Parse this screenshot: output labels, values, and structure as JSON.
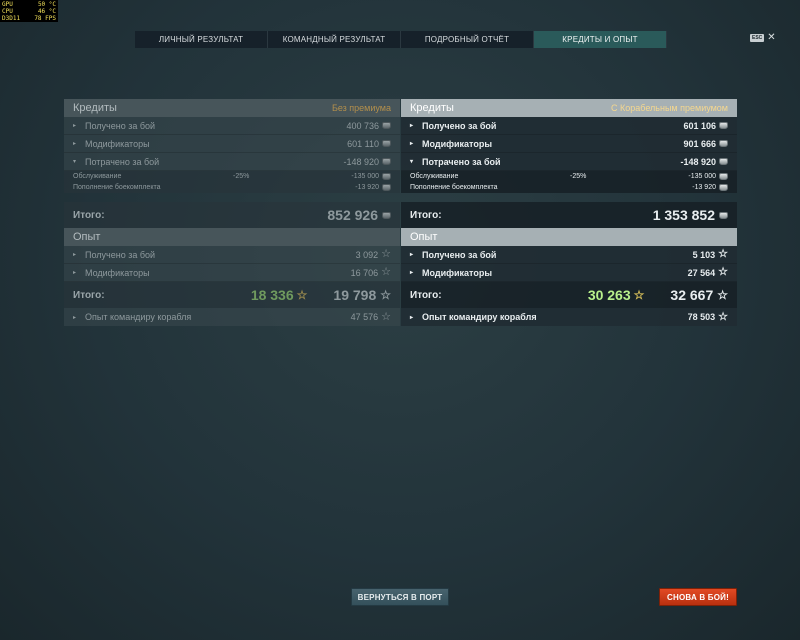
{
  "hw": {
    "rows": [
      {
        "label": "GPU",
        "value": "50 °C"
      },
      {
        "label": "CPU",
        "value": "46 °C"
      },
      {
        "label": "D3D11",
        "value": "78 FPS"
      }
    ]
  },
  "tabs": [
    {
      "label": "ЛИЧНЫЙ РЕЗУЛЬТАТ",
      "active": false
    },
    {
      "label": "КОМАНДНЫЙ РЕЗУЛЬТАТ",
      "active": false
    },
    {
      "label": "ПОДРОБНЫЙ ОТЧЁТ",
      "active": false
    },
    {
      "label": "КРЕДИТЫ И ОПЫТ",
      "active": true
    }
  ],
  "esc": {
    "key_label": "ESC",
    "close_glyph": "✕"
  },
  "left": {
    "credits_title": "Кредиты",
    "credits_subtitle": "Без премиума",
    "earned_label": "Получено за бой",
    "earned_value": "400 736",
    "modifiers_label": "Модификаторы",
    "modifiers_value": "601 110",
    "spent_label": "Потрачено за бой",
    "spent_value": "-148 920",
    "service_label": "Обслуживание",
    "service_pct": "-25%",
    "service_value": "-135 000",
    "ammo_label": "Пополнение боекомплекта",
    "ammo_value": "-13 920",
    "total_label": "Итого:",
    "total_value": "852 926",
    "xp_title": "Опыт",
    "xp_earned_label": "Получено за бой",
    "xp_earned_value": "3 092",
    "xp_modifiers_label": "Модификаторы",
    "xp_modifiers_value": "16 706",
    "xp_total_label": "Итого:",
    "xp_total_free": "18 336",
    "xp_total_value": "19 798",
    "commander_label": "Опыт командиру корабля",
    "commander_value": "47 576"
  },
  "right": {
    "credits_title": "Кредиты",
    "credits_subtitle": "С Корабельным премиумом",
    "earned_label": "Получено за бой",
    "earned_value": "601 106",
    "modifiers_label": "Модификаторы",
    "modifiers_value": "901 666",
    "spent_label": "Потрачено за бой",
    "spent_value": "-148 920",
    "service_label": "Обслуживание",
    "service_pct": "-25%",
    "service_value": "-135 000",
    "ammo_label": "Пополнение боекомплекта",
    "ammo_value": "-13 920",
    "total_label": "Итого:",
    "total_value": "1 353 852",
    "xp_title": "Опыт",
    "xp_earned_label": "Получено за бой",
    "xp_earned_value": "5 103",
    "xp_modifiers_label": "Модификаторы",
    "xp_modifiers_value": "27 564",
    "xp_total_label": "Итого:",
    "xp_total_free": "30 263",
    "xp_total_value": "32 667",
    "commander_label": "Опыт командиру корабля",
    "commander_value": "78 503"
  },
  "buttons": {
    "port": "ВЕРНУТЬСЯ В ПОРТ",
    "battle": "СНОВА В БОЙ!"
  },
  "icons": {
    "caret_right": "▸",
    "caret_down": "▾",
    "star": "☆"
  },
  "colors": {
    "accent_tab": "#2a5a5a",
    "premium_gold": "#f5d78e",
    "free_xp_green": "#b8f08c",
    "battle_red": "#e24a24"
  }
}
